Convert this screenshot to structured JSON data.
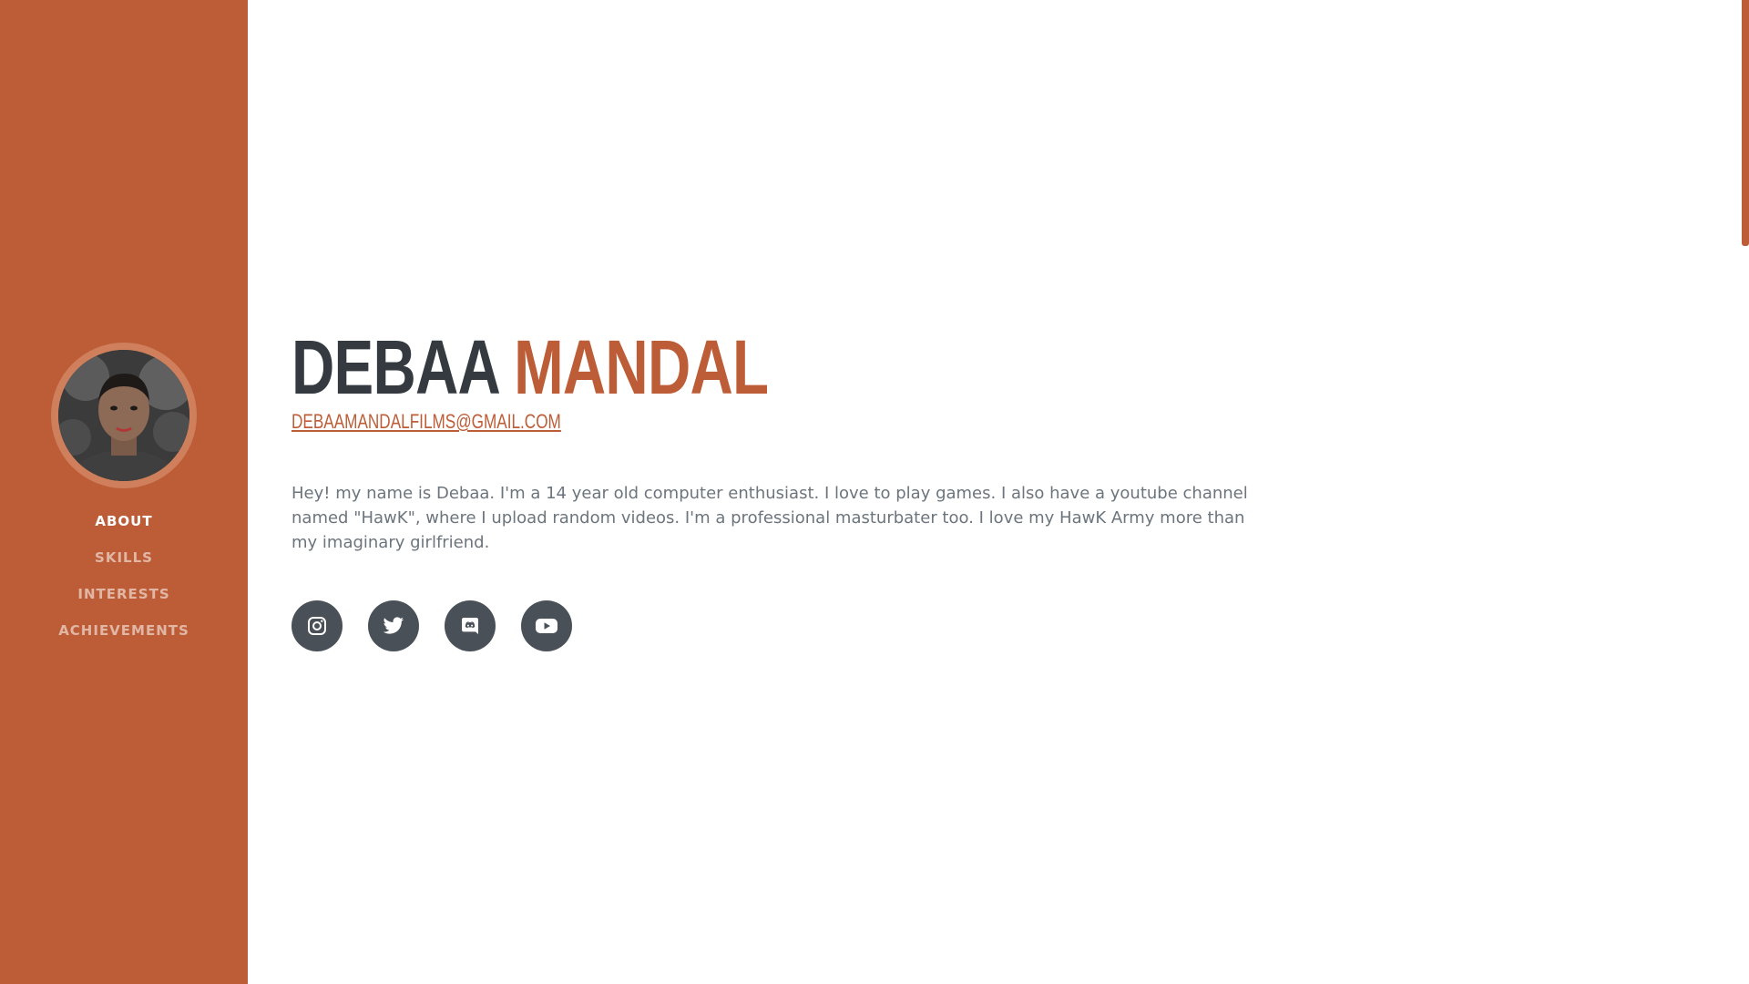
{
  "colors": {
    "primary": "#bd5d38",
    "dark": "#343a40",
    "muted": "#6c757d",
    "icon_bg": "#495057"
  },
  "sidebar": {
    "avatar_alt": "profile photo",
    "nav": [
      {
        "label": "ABOUT",
        "active": true
      },
      {
        "label": "SKILLS",
        "active": false
      },
      {
        "label": "INTERESTS",
        "active": false
      },
      {
        "label": "ACHIEVEMENTS",
        "active": false
      }
    ]
  },
  "about": {
    "first_name": "DEBAA",
    "last_name": "MANDAL",
    "email": "DEBAAMANDALFILMS@GMAIL.COM",
    "bio": "Hey! my name is Debaa. I'm a 14 year old computer enthusiast. I love to play games. I also have a youtube channel named \"HawK\", where I upload random videos. I'm a professional masturbater too. I love my HawK Army more than my imaginary girlfriend."
  },
  "social": [
    {
      "icon": "instagram-icon"
    },
    {
      "icon": "twitter-icon"
    },
    {
      "icon": "discord-icon"
    },
    {
      "icon": "youtube-icon"
    }
  ]
}
